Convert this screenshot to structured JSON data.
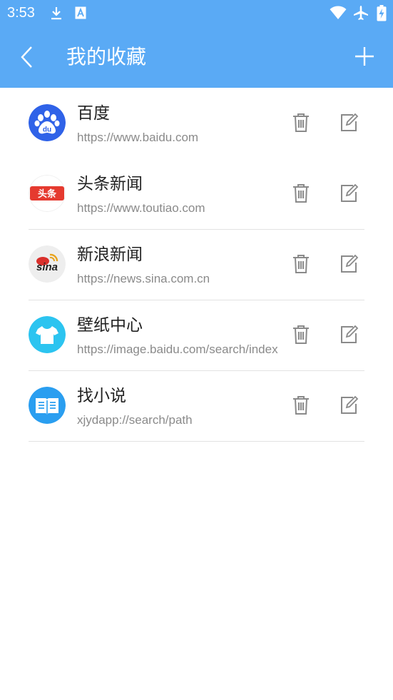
{
  "status_bar": {
    "time": "3:53",
    "icons": [
      "download-icon",
      "app-notification-icon",
      "wifi-icon",
      "airplane-icon",
      "battery-charging-icon"
    ]
  },
  "app_bar": {
    "title": "我的收藏",
    "back_icon": "chevron-left-icon",
    "add_icon": "plus-icon",
    "color": "#5aaaf5"
  },
  "favorites": [
    {
      "title": "百度",
      "url": "https://www.baidu.com",
      "icon": "baidu-logo",
      "delete_icon": "trash-icon",
      "edit_icon": "edit-icon"
    },
    {
      "title": "头条新闻",
      "url": "https://www.toutiao.com",
      "icon": "toutiao-logo",
      "logo_text": "头条",
      "delete_icon": "trash-icon",
      "edit_icon": "edit-icon"
    },
    {
      "title": "新浪新闻",
      "url": "https://news.sina.com.cn",
      "icon": "sina-logo",
      "logo_text": "sina",
      "delete_icon": "trash-icon",
      "edit_icon": "edit-icon"
    },
    {
      "title": "壁纸中心",
      "url": "https://image.baidu.com/search/index",
      "icon": "tshirt-logo",
      "delete_icon": "trash-icon",
      "edit_icon": "edit-icon"
    },
    {
      "title": "找小说",
      "url": "xjydapp://search/path",
      "icon": "book-logo",
      "delete_icon": "trash-icon",
      "edit_icon": "edit-icon"
    }
  ]
}
